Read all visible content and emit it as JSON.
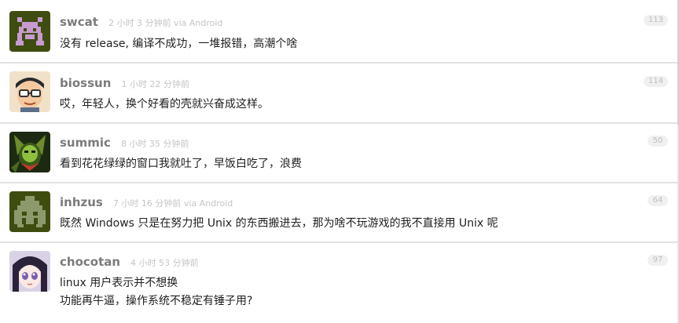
{
  "replies": [
    {
      "username": "swcat",
      "ago": "2 小时 3 分钟前 via Android",
      "content": "没有 release, 编译不成功，一堆报错，高潮个啥",
      "number": "113",
      "avatar": "pixel-invader-avatar"
    },
    {
      "username": "biossun",
      "ago": "1 小时 22 分钟前",
      "content": "哎，年轻人，换个好看的壳就兴奋成这样。",
      "number": "114",
      "avatar": "cartoon-glasses-avatar"
    },
    {
      "username": "summic",
      "ago": "8 小时 35 分钟前",
      "content": "看到花花绿绿的窗口我就吐了，早饭白吃了，浪费",
      "number": "50",
      "avatar": "dota-hero-avatar"
    },
    {
      "username": "inhzus",
      "ago": "7 小时 16 分钟前 via Android",
      "content": "既然 Windows 只是在努力把 Unix 的东西搬进去，那为啥不玩游戏的我不直接用 Unix 呢",
      "number": "64",
      "avatar": "pixel-ghost-avatar"
    },
    {
      "username": "chocotan",
      "ago": "4 小时 53 分钟前",
      "content": "linux 用户表示并不想换",
      "content2": "功能再牛逼，操作系统不稳定有锤子用?",
      "number": "97",
      "avatar": "anime-girl-avatar"
    }
  ],
  "colors": {
    "username": "#7b7b7b",
    "time": "#c4c4c4",
    "text": "#1f1f1f",
    "page_bg": "#e2e2e2"
  }
}
